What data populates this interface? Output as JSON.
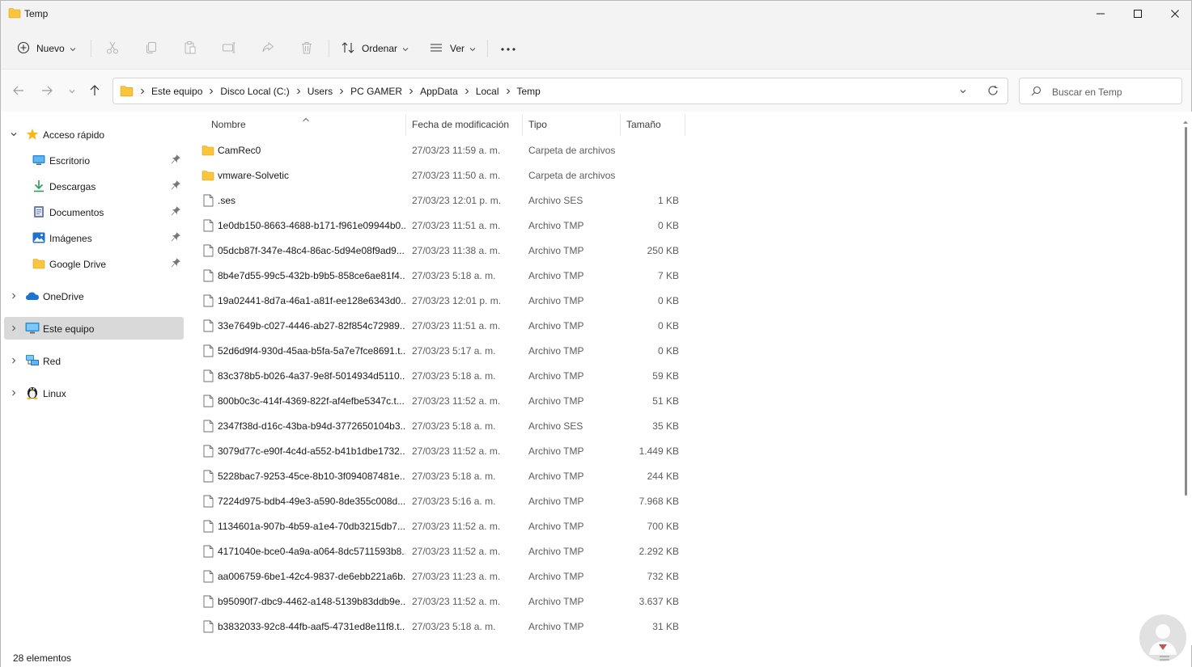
{
  "window": {
    "title": "Temp"
  },
  "toolbar": {
    "new_label": "Nuevo",
    "sort_label": "Ordenar",
    "view_label": "Ver",
    "more_label": "..."
  },
  "address": {
    "crumbs": [
      "Este equipo",
      "Disco Local (C:)",
      "Users",
      "PC GAMER",
      "AppData",
      "Local",
      "Temp"
    ]
  },
  "search": {
    "placeholder": "Buscar en Temp"
  },
  "sidebar": {
    "quick_access": "Acceso rápido",
    "pinned": [
      {
        "label": "Escritorio",
        "icon": "desktop-icon"
      },
      {
        "label": "Descargas",
        "icon": "download-icon"
      },
      {
        "label": "Documentos",
        "icon": "documents-icon"
      },
      {
        "label": "Imágenes",
        "icon": "pictures-icon"
      },
      {
        "label": "Google Drive",
        "icon": "folder-icon"
      }
    ],
    "onedrive": "OneDrive",
    "this_pc": "Este equipo",
    "network": "Red",
    "linux": "Linux"
  },
  "columns": {
    "name": "Nombre",
    "date": "Fecha de modificación",
    "type": "Tipo",
    "size": "Tamaño"
  },
  "files": [
    {
      "name": "CamRec0",
      "date": "27/03/23 11:59 a. m.",
      "type": "Carpeta de archivos",
      "size": "",
      "kind": "folder"
    },
    {
      "name": "vmware-Solvetic",
      "date": "27/03/23 11:50 a. m.",
      "type": "Carpeta de archivos",
      "size": "",
      "kind": "folder"
    },
    {
      "name": ".ses",
      "date": "27/03/23 12:01 p. m.",
      "type": "Archivo SES",
      "size": "1 KB",
      "kind": "file"
    },
    {
      "name": "1e0db150-8663-4688-b171-f961e09944b0....",
      "date": "27/03/23 11:51 a. m.",
      "type": "Archivo TMP",
      "size": "0 KB",
      "kind": "file"
    },
    {
      "name": "05dcb87f-347e-48c4-86ac-5d94e08f9ad9....",
      "date": "27/03/23 11:38 a. m.",
      "type": "Archivo TMP",
      "size": "250 KB",
      "kind": "file"
    },
    {
      "name": "8b4e7d55-99c5-432b-b9b5-858ce6ae81f4....",
      "date": "27/03/23 5:18 a. m.",
      "type": "Archivo TMP",
      "size": "7 KB",
      "kind": "file"
    },
    {
      "name": "19a02441-8d7a-46a1-a81f-ee128e6343d0....",
      "date": "27/03/23 12:01 p. m.",
      "type": "Archivo TMP",
      "size": "0 KB",
      "kind": "file"
    },
    {
      "name": "33e7649b-c027-4446-ab27-82f854c72989....",
      "date": "27/03/23 11:51 a. m.",
      "type": "Archivo TMP",
      "size": "0 KB",
      "kind": "file"
    },
    {
      "name": "52d6d9f4-930d-45aa-b5fa-5a7e7fce8691.t...",
      "date": "27/03/23 5:17 a. m.",
      "type": "Archivo TMP",
      "size": "0 KB",
      "kind": "file"
    },
    {
      "name": "83c378b5-b026-4a37-9e8f-5014934d5110....",
      "date": "27/03/23 5:18 a. m.",
      "type": "Archivo TMP",
      "size": "59 KB",
      "kind": "file"
    },
    {
      "name": "800b0c3c-414f-4369-822f-af4efbe5347c.t...",
      "date": "27/03/23 11:52 a. m.",
      "type": "Archivo TMP",
      "size": "51 KB",
      "kind": "file"
    },
    {
      "name": "2347f38d-d16c-43ba-b94d-3772650104b3....",
      "date": "27/03/23 5:18 a. m.",
      "type": "Archivo SES",
      "size": "35 KB",
      "kind": "file"
    },
    {
      "name": "3079d77c-e90f-4c4d-a552-b41b1dbe1732....",
      "date": "27/03/23 11:52 a. m.",
      "type": "Archivo TMP",
      "size": "1.449 KB",
      "kind": "file"
    },
    {
      "name": "5228bac7-9253-45ce-8b10-3f094087481e....",
      "date": "27/03/23 5:18 a. m.",
      "type": "Archivo TMP",
      "size": "244 KB",
      "kind": "file"
    },
    {
      "name": "7224d975-bdb4-49e3-a590-8de355c008d...",
      "date": "27/03/23 5:16 a. m.",
      "type": "Archivo TMP",
      "size": "7.968 KB",
      "kind": "file"
    },
    {
      "name": "1134601a-907b-4b59-a1e4-70db3215db7...",
      "date": "27/03/23 11:52 a. m.",
      "type": "Archivo TMP",
      "size": "700 KB",
      "kind": "file"
    },
    {
      "name": "4171040e-bce0-4a9a-a064-8dc5711593b8....",
      "date": "27/03/23 11:52 a. m.",
      "type": "Archivo TMP",
      "size": "2.292 KB",
      "kind": "file"
    },
    {
      "name": "aa006759-6be1-42c4-9837-de6ebb221a6b....",
      "date": "27/03/23 11:23 a. m.",
      "type": "Archivo TMP",
      "size": "732 KB",
      "kind": "file"
    },
    {
      "name": "b95090f7-dbc9-4462-a148-5139b83ddb9e....",
      "date": "27/03/23 11:52 a. m.",
      "type": "Archivo TMP",
      "size": "3.637 KB",
      "kind": "file"
    },
    {
      "name": "b3832033-92c8-44fb-aaf5-4731ed8e11f8.t...",
      "date": "27/03/23 5:18 a. m.",
      "type": "Archivo TMP",
      "size": "31 KB",
      "kind": "file"
    }
  ],
  "status": {
    "count_text": "28 elementos"
  },
  "colors": {
    "accent": "#0067c0",
    "folder": "#f8c53c",
    "selected_bg": "#d9d9d9"
  }
}
